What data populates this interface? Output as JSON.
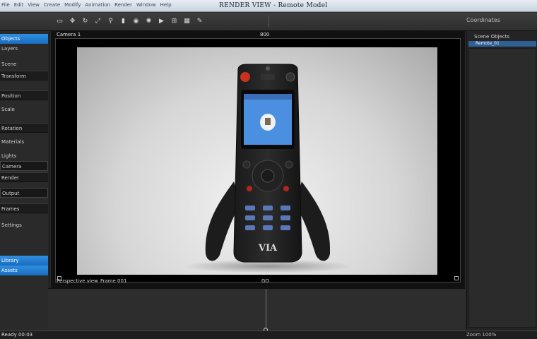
{
  "window": {
    "title": "RENDER VIEW - Remote Model",
    "menu": [
      "File",
      "Edit",
      "View",
      "Create",
      "Modify",
      "Animation",
      "Render",
      "Window",
      "Help"
    ]
  },
  "toolbar": {
    "right_label": "Coordinates"
  },
  "left_panel": {
    "rows": [
      {
        "label": "Objects",
        "style": "blue"
      },
      {
        "label": "Layers",
        "style": "plain"
      },
      {
        "label": "Scene",
        "style": "plain"
      },
      {
        "label": "Transform",
        "style": "dark"
      },
      {
        "label": "Position",
        "style": "dark"
      },
      {
        "label": "Scale",
        "style": "plain"
      },
      {
        "label": "Rotation",
        "style": "dark"
      },
      {
        "label": "Materials",
        "style": "plain"
      },
      {
        "label": "Lights",
        "style": "plain"
      },
      {
        "label": "Camera",
        "style": "field"
      },
      {
        "label": "Render",
        "style": "dark"
      },
      {
        "label": "Output",
        "style": "field"
      },
      {
        "label": "Frames",
        "style": "dark"
      },
      {
        "label": "Settings",
        "style": "plain"
      },
      {
        "label": "Library",
        "style": "blue"
      },
      {
        "label": "Assets",
        "style": "blue"
      }
    ]
  },
  "viewport": {
    "header_left": "Camera 1",
    "header_center": "800",
    "footer_left": "Perspective view",
    "footer_center": "Frame 001",
    "footer_right": "GO",
    "model": {
      "brand": "VIA",
      "screen_color": "#4a8fe0",
      "button_color": "#5a78b8"
    }
  },
  "right_panel": {
    "header": "Scene Objects",
    "selected_row": "Remote_01"
  },
  "statusbar": {
    "left": "Ready  00:03",
    "right": "Zoom  100%"
  }
}
